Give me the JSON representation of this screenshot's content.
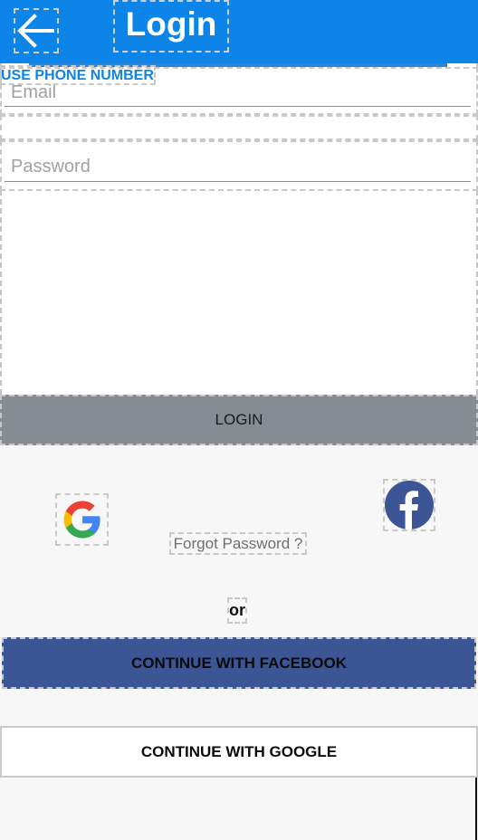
{
  "header": {
    "title": "Login",
    "back_icon": "arrow-left-icon",
    "background": "#0c84e8"
  },
  "form": {
    "phone_link_label": "USE PHONE NUMBER",
    "email_placeholder": "Email",
    "password_placeholder": "Password"
  },
  "login_button_label": "LOGIN",
  "social": {
    "google_icon": "google-icon",
    "facebook_icon": "facebook-icon"
  },
  "forgot_password_label": "Forgot Password ?",
  "divider_label": "or",
  "continue_facebook_label": "CONTINUE WITH FACEBOOK",
  "continue_google_label": "CONTINUE WITH GOOGLE",
  "colors": {
    "accent": "#0c84e8",
    "facebook": "#3b5595",
    "login_button": "#878c93"
  }
}
